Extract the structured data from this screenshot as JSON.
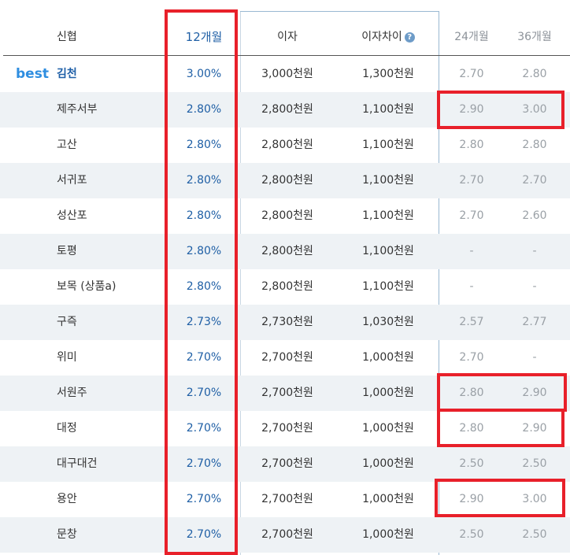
{
  "header": {
    "name": "신협",
    "term12": "12개월",
    "interest": "이자",
    "diff": "이자차이",
    "help_icon": "?",
    "term24": "24개월",
    "term36": "36개월"
  },
  "best_label": "best",
  "rows": [
    {
      "name": "김천",
      "r12": "3.00%",
      "interest": "3,000천원",
      "diff": "1,300천원",
      "r24": "2.70",
      "r36": "2.80"
    },
    {
      "name": "제주서부",
      "r12": "2.80%",
      "interest": "2,800천원",
      "diff": "1,100천원",
      "r24": "2.90",
      "r36": "3.00"
    },
    {
      "name": "고산",
      "r12": "2.80%",
      "interest": "2,800천원",
      "diff": "1,100천원",
      "r24": "2.80",
      "r36": "2.80"
    },
    {
      "name": "서귀포",
      "r12": "2.80%",
      "interest": "2,800천원",
      "diff": "1,100천원",
      "r24": "2.70",
      "r36": "2.70"
    },
    {
      "name": "성산포",
      "r12": "2.80%",
      "interest": "2,800천원",
      "diff": "1,100천원",
      "r24": "2.70",
      "r36": "2.60"
    },
    {
      "name": "토평",
      "r12": "2.80%",
      "interest": "2,800천원",
      "diff": "1,100천원",
      "r24": "-",
      "r36": "-"
    },
    {
      "name": "보목 (상품a)",
      "r12": "2.80%",
      "interest": "2,800천원",
      "diff": "1,100천원",
      "r24": "-",
      "r36": "-"
    },
    {
      "name": "구즉",
      "r12": "2.73%",
      "interest": "2,730천원",
      "diff": "1,030천원",
      "r24": "2.57",
      "r36": "2.77"
    },
    {
      "name": "위미",
      "r12": "2.70%",
      "interest": "2,700천원",
      "diff": "1,000천원",
      "r24": "2.70",
      "r36": "-"
    },
    {
      "name": "서원주",
      "r12": "2.70%",
      "interest": "2,700천원",
      "diff": "1,000천원",
      "r24": "2.80",
      "r36": "2.90"
    },
    {
      "name": "대정",
      "r12": "2.70%",
      "interest": "2,700천원",
      "diff": "1,000천원",
      "r24": "2.80",
      "r36": "2.90"
    },
    {
      "name": "대구대건",
      "r12": "2.70%",
      "interest": "2,700천원",
      "diff": "1,000천원",
      "r24": "2.50",
      "r36": "2.50"
    },
    {
      "name": "용안",
      "r12": "2.70%",
      "interest": "2,700천원",
      "diff": "1,000천원",
      "r24": "2.90",
      "r36": "3.00"
    },
    {
      "name": "문창",
      "r12": "2.70%",
      "interest": "2,700천원",
      "diff": "1,000천원",
      "r24": "2.50",
      "r36": "2.50"
    }
  ],
  "highlight_color": "#e8202a"
}
